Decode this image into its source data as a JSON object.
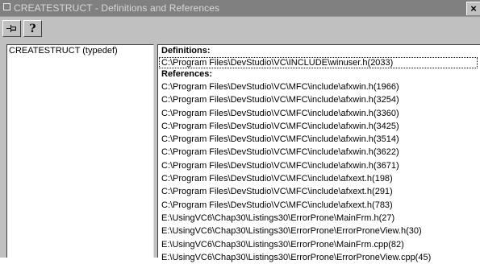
{
  "window": {
    "title": "CREATESTRUCT - Definitions and References",
    "close_label": "×"
  },
  "toolbar": {
    "buttons": [
      {
        "icon": "pin-icon"
      },
      {
        "icon": "help-icon",
        "label": "?"
      }
    ]
  },
  "symbols": {
    "items": [
      "CREATESTRUCT (typedef)"
    ]
  },
  "definitions": {
    "heading": "Definitions:",
    "items": [
      "C:\\Program Files\\DevStudio\\VC\\INCLUDE\\winuser.h(2033)"
    ]
  },
  "references": {
    "heading": "References:",
    "items": [
      "C:\\Program Files\\DevStudio\\VC\\MFC\\include\\afxwin.h(1966)",
      "C:\\Program Files\\DevStudio\\VC\\MFC\\include\\afxwin.h(3254)",
      "C:\\Program Files\\DevStudio\\VC\\MFC\\include\\afxwin.h(3360)",
      "C:\\Program Files\\DevStudio\\VC\\MFC\\include\\afxwin.h(3425)",
      "C:\\Program Files\\DevStudio\\VC\\MFC\\include\\afxwin.h(3514)",
      "C:\\Program Files\\DevStudio\\VC\\MFC\\include\\afxwin.h(3622)",
      "C:\\Program Files\\DevStudio\\VC\\MFC\\include\\afxwin.h(3671)",
      "C:\\Program Files\\DevStudio\\VC\\MFC\\include\\afxext.h(198)",
      "C:\\Program Files\\DevStudio\\VC\\MFC\\include\\afxext.h(291)",
      "C:\\Program Files\\DevStudio\\VC\\MFC\\include\\afxext.h(783)",
      "E:\\UsingVC6\\Chap30\\Listings30\\ErrorProne\\MainFrm.h(27)",
      "E:\\UsingVC6\\Chap30\\Listings30\\ErrorProne\\ErrorProneView.h(30)",
      "E:\\UsingVC6\\Chap30\\Listings30\\ErrorProne\\MainFrm.cpp(82)",
      "E:\\UsingVC6\\Chap30\\Listings30\\ErrorProne\\ErrorProneView.cpp(45)"
    ]
  },
  "colors": {
    "titlebar": "#808080",
    "face": "#c0c0c0",
    "panel": "#ffffff",
    "text": "#000000"
  }
}
